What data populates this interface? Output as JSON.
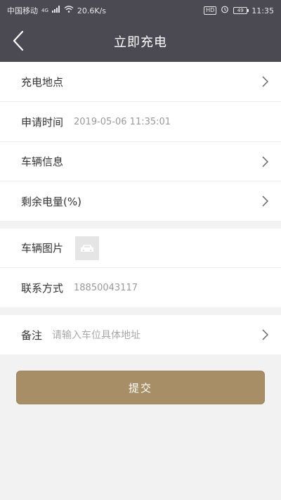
{
  "status_bar": {
    "carrier": "中国移动",
    "network": "4G",
    "speed": "20.6K/s",
    "hd": "HD",
    "battery": "49",
    "time": "11:35"
  },
  "header": {
    "title": "立即充电"
  },
  "form": {
    "location_label": "充电地点",
    "apply_time_label": "申请时间",
    "apply_time_value": "2019-05-06 11:35:01",
    "vehicle_info_label": "车辆信息",
    "remaining_charge_label": "剩余电量(%)",
    "vehicle_image_label": "车辆图片",
    "contact_label": "联系方式",
    "contact_value": "18850043117",
    "remark_label": "备注",
    "remark_placeholder": "请输入车位具体地址"
  },
  "submit": {
    "label": "提交"
  },
  "colors": {
    "header_bg": "#4b4a52",
    "accent": "#a78e66",
    "page_bg": "#f2f2f2"
  },
  "icons": [
    "back-arrow-icon",
    "chevron-right-icon",
    "car-placeholder-icon",
    "wifi-icon",
    "signal-icon",
    "alarm-icon",
    "battery-icon"
  ]
}
